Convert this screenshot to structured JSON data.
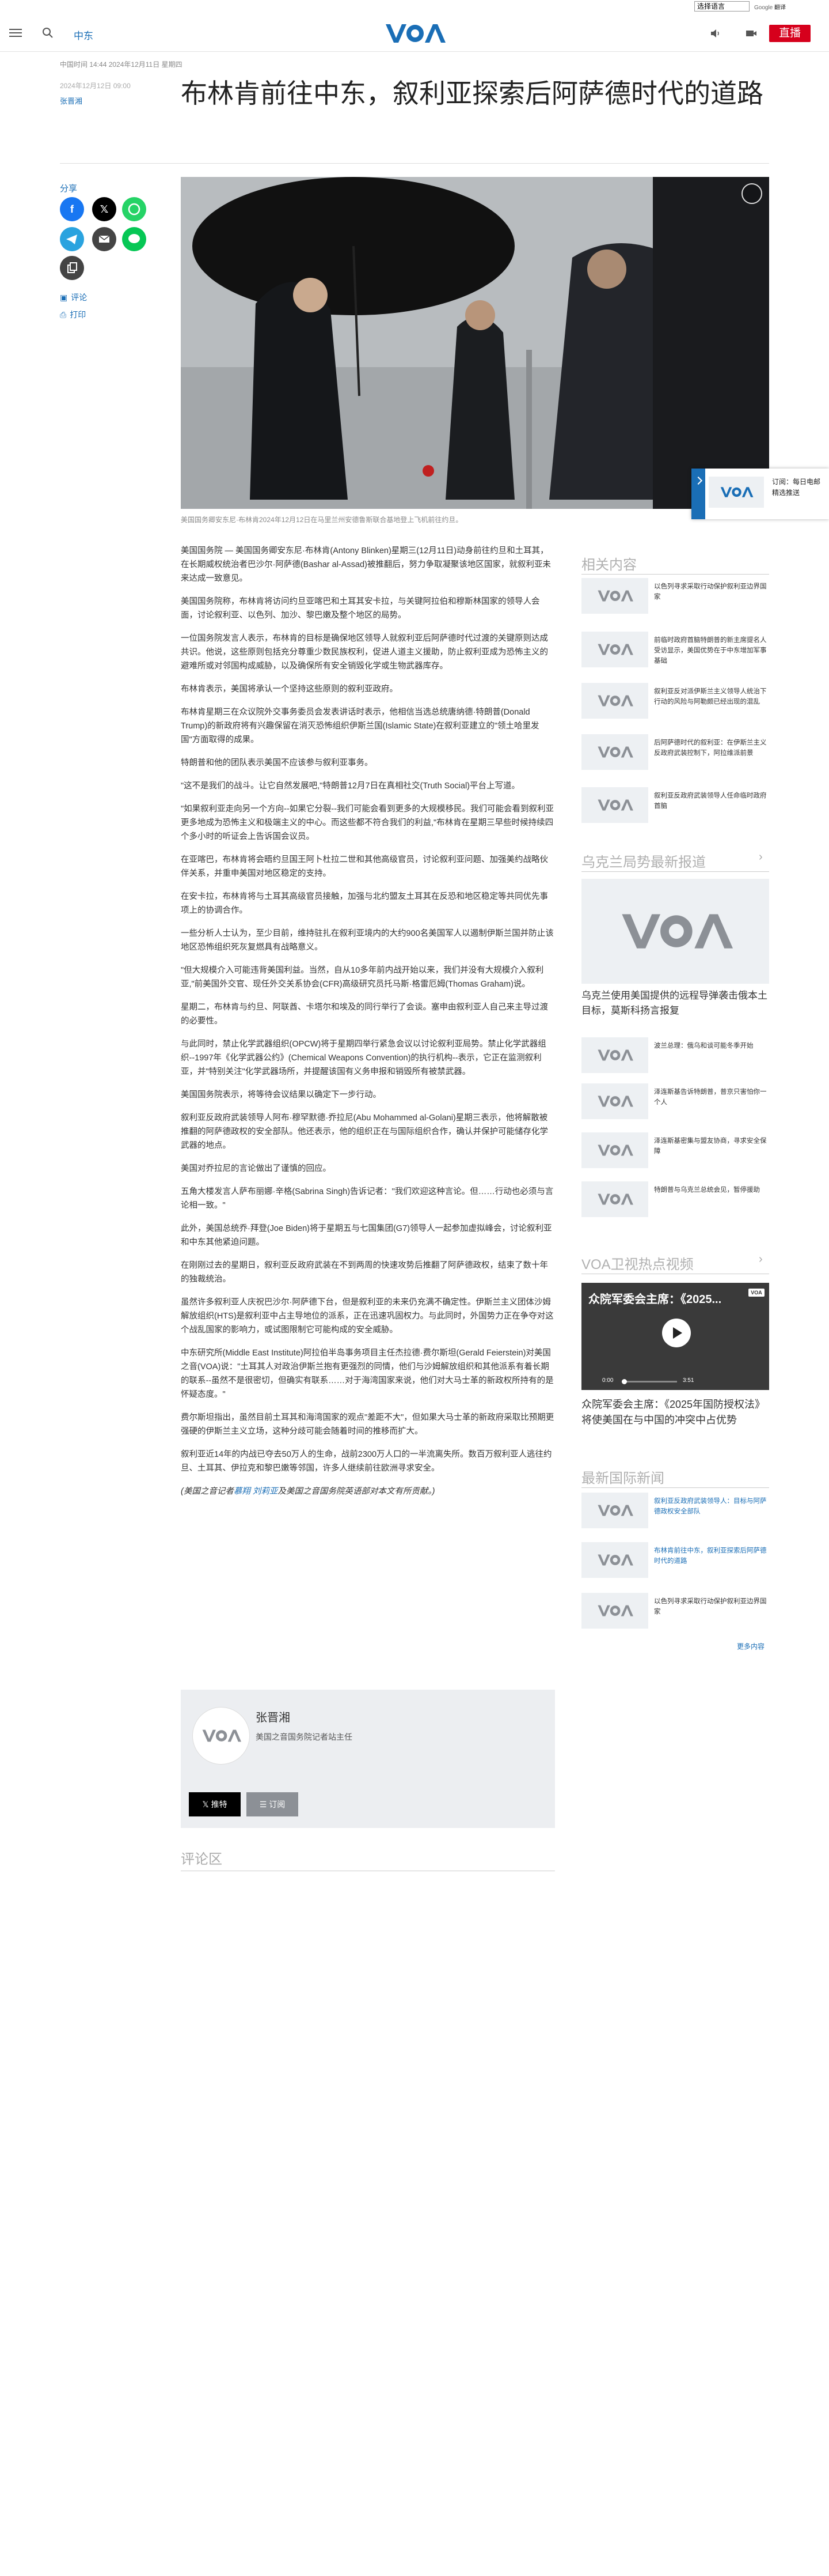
{
  "top_strip": {
    "language_select": "选择语言",
    "google_translate": "Google",
    "translate_label": "翻译"
  },
  "header": {
    "site_section": "中东",
    "live_button": "直播"
  },
  "article_meta": {
    "updated": "中国时间 14:44 2024年12月11日 星期四",
    "date": "2024年12月12日 09:00",
    "author": "张晋湘"
  },
  "headline": "布林肯前往中东，叙利亚探索后阿萨德时代的道路",
  "share": {
    "label": "分享",
    "comment_link": "评论",
    "print_link": "打印"
  },
  "photo": {
    "caption": "美国国务卿安东尼·布林肯2024年12月12日在马里兰州安德鲁斯联合基地登上飞机前往约旦。"
  },
  "body_paragraphs": [
    "美国国务院 — 美国国务卿安东尼·布林肯(Antony Blinken)星期三(12月11日)动身前往约旦和土耳其，在长期威权统治者巴沙尔·阿萨德(Bashar al-Assad)被推翻后，努力争取凝聚该地区国家，就叙利亚未来达成一致意见。",
    "美国国务院称，布林肯将访问约旦亚喀巴和土耳其安卡拉，与关键阿拉伯和穆斯林国家的领导人会面，讨论叙利亚、以色列、加沙、黎巴嫩及整个地区的局势。",
    "一位国务院发言人表示，布林肯的目标是确保地区领导人就叙利亚后阿萨德时代过渡的关键原则达成共识。他说，这些原则包括充分尊重少数民族权利，促进人道主义援助，防止叙利亚成为恐怖主义的避难所或对邻国构成威胁，以及确保所有安全销毁化学或生物武器库存。",
    "布林肯表示，美国将承认一个坚持这些原则的叙利亚政府。",
    "布林肯星期三在众议院外交事务委员会发表讲话时表示，他相信当选总统唐纳德·特朗普(Donald Trump)的新政府将有兴趣保留在消灭恐怖组织伊斯兰国(Islamic State)在叙利亚建立的\"领土哈里发国\"方面取得的成果。",
    "特朗普和他的团队表示美国不应该参与叙利亚事务。",
    "\"这不是我们的战斗。让它自然发展吧,\"特朗普12月7日在真相社交(Truth Social)平台上写道。",
    "\"如果叙利亚走向另一个方向--如果它分裂--我们可能会看到更多的大规模移民。我们可能会看到叙利亚更多地成为恐怖主义和极端主义的中心。而这些都不符合我们的利益,\"布林肯在星期三早些时候持续四个多小时的听证会上告诉国会议员。",
    "在亚喀巴，布林肯将会晤约旦国王阿卜杜拉二世和其他高级官员，讨论叙利亚问题、加强美约战略伙伴关系，并重申美国对地区稳定的支持。",
    "在安卡拉，布林肯将与土耳其高级官员接触，加强与北约盟友土耳其在反恐和地区稳定等共同优先事项上的协调合作。",
    "一些分析人士认为，至少目前，维持驻扎在叙利亚境内的大约900名美国军人以遏制伊斯兰国并防止该地区恐怖组织死灰复燃具有战略意义。",
    "\"但大规模介入可能违背美国利益。当然，自从10多年前内战开始以来，我们并没有大规模介入叙利亚,\"前美国外交官、现任外交关系协会(CFR)高级研究员托马斯·格雷厄姆(Thomas Graham)说。",
    "星期二，布林肯与约旦、阿联酋、卡塔尔和埃及的同行举行了会谈。塞申由叙利亚人自己来主导过渡的必要性。",
    "与此同时，禁止化学武器组织(OPCW)将于星期四举行紧急会议以讨论叙利亚局势。禁止化学武器组织--1997年《化学武器公约》(Chemical Weapons Convention)的执行机构--表示，它正在监测叙利亚，并\"特别关注\"化学武器场所，并提醒该国有义务申报和销毁所有被禁武器。",
    "美国国务院表示，将等待会议结果以确定下一步行动。",
    "叙利亚反政府武装领导人阿布·穆罕默德·乔拉尼(Abu Mohammed al-Golani)星期三表示，他将解散被推翻的阿萨德政权的安全部队。他还表示，他的组织正在与国际组织合作，确认并保护可能储存化学武器的地点。",
    "美国对乔拉尼的言论做出了谨慎的回应。",
    "五角大楼发言人萨布丽娜·辛格(Sabrina Singh)告诉记者：\"我们欢迎这种言论。但……行动也必须与言论相一致。\"",
    "此外，美国总统乔·拜登(Joe Biden)将于星期五与七国集团(G7)领导人一起参加虚拟峰会，讨论叙利亚和中东其他紧迫问题。",
    "在刚刚过去的星期日，叙利亚反政府武装在不到两周的快速攻势后推翻了阿萨德政权，结束了数十年的独裁统治。",
    "虽然许多叙利亚人庆祝巴沙尔·阿萨德下台，但是叙利亚的未来仍充满不确定性。伊斯兰主义团体沙姆解放组织(HTS)是叙利亚中占主导地位的派系，正在迅速巩固权力。与此同时，外国势力正在争夺对这个战乱国家的影响力，或试图限制它可能构成的安全威胁。",
    "中东研究所(Middle East Institute)阿拉伯半岛事务项目主任杰拉德·费尔斯坦(Gerald Feierstein)对美国之音(VOA)说：\"土耳其人对政治伊斯兰抱有更强烈的同情，他们与沙姆解放组织和其他派系有着长期的联系--虽然不是很密切，但确实有联系……对于海湾国家来说，他们对大马士革的新政权所持有的是怀疑态度。\"",
    "费尔斯坦指出，虽然目前土耳其和海湾国家的观点\"差距不大\"，但如果大马士革的新政府采取比预期更强硬的伊斯兰主义立场，这种分歧可能会随着时间的推移而扩大。",
    "叙利亚近14年的内战已夺去50万人的生命，战前2300万人口的一半流离失所。数百万叙利亚人逃往约旦、土耳其、伊拉克和黎巴嫩等邻国，许多人继续前往欧洲寻求安全。"
  ],
  "credit": {
    "prefix": "(美国之音记者",
    "names": "慕翔 刘莉亚",
    "suffix": "及美国之音国务院英语部对本文有所贡献。)"
  },
  "author_box": {
    "name": "张晋湘",
    "role": "美国之音国务院记者站主任",
    "twitter_button": "推特",
    "rss_button": "订阅"
  },
  "comments": {
    "heading": "评论区"
  },
  "sidebar": {
    "related_heading": "相关内容",
    "related": [
      {
        "title": "以色列寻求采取行动保护叙利亚边界国家"
      },
      {
        "title": "前临时政府首脑特朗普的新主席提名人受访显示，美国优势在于中东增加军事基础"
      },
      {
        "title": "叙利亚反对派伊斯兰主义领导人统治下行动的风险与阿勒颇已经出现的混乱"
      },
      {
        "title": "后阿萨德时代的叙利亚：在伊斯兰主义反政府武装控制下，阿拉维派前景"
      },
      {
        "title": "叙利亚反政府武装领导人任命临时政府首脑"
      }
    ],
    "ukraine_heading": "乌克兰局势最新报道",
    "ukraine_feature": "乌克兰使用美国提供的远程导弹袭击俄本土目标，莫斯科扬言报复",
    "ukraine": [
      {
        "title": "波兰总理：俄乌和谈可能冬季开始"
      },
      {
        "title": "泽连斯基告诉特朗普，普京只害怕你一个人"
      },
      {
        "title": "泽连斯基密集与盟友协商，寻求安全保障"
      },
      {
        "title": "特朗普与乌克兰总统会见，暂停援助"
      }
    ],
    "video_heading": "VOA卫视热点视频",
    "video": {
      "overlay_title": "众院军委会主席：《2025...",
      "time_current": "0:00",
      "time_total": "3:51",
      "logo": "VOA",
      "caption": "众院军委会主席：《2025年国防授权法》将使美国在与中国的冲突中占优势"
    },
    "news_heading": "最新国际新闻",
    "news": [
      {
        "title": "叙利亚反政府武装领导人：目标与阿萨德政权安全部队"
      },
      {
        "title": "布林肯前往中东，叙利亚探索后阿萨德时代的道路"
      },
      {
        "title": "以色列寻求采取行动保护叙利亚边界国家"
      }
    ],
    "more_link": "更多内容"
  },
  "popup": {
    "text": "订阅：每日电邮 精选推送"
  },
  "colors": {
    "accent": "#1a6eb6",
    "live": "#d6001c"
  }
}
